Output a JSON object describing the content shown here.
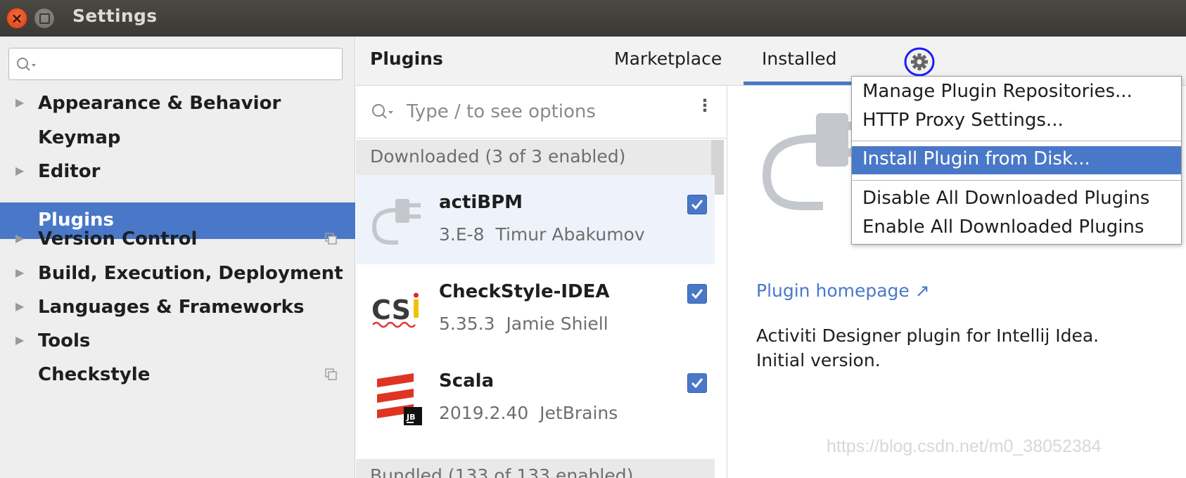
{
  "window": {
    "title": "Settings"
  },
  "sidebar": {
    "search_placeholder": "",
    "items": [
      {
        "label": "Appearance & Behavior",
        "expandable": true,
        "project_icon": false
      },
      {
        "label": "Keymap",
        "expandable": false,
        "project_icon": false
      },
      {
        "label": "Editor",
        "expandable": true,
        "project_icon": false
      },
      {
        "label": "Plugins",
        "expandable": false,
        "project_icon": false,
        "selected": true
      },
      {
        "label": "Version Control",
        "expandable": true,
        "project_icon": true
      },
      {
        "label": "Build, Execution, Deployment",
        "expandable": true,
        "project_icon": false
      },
      {
        "label": "Languages & Frameworks",
        "expandable": true,
        "project_icon": false
      },
      {
        "label": "Tools",
        "expandable": true,
        "project_icon": false
      },
      {
        "label": "Checkstyle",
        "expandable": false,
        "project_icon": true
      }
    ]
  },
  "header": {
    "title": "Plugins",
    "tabs": [
      {
        "label": "Marketplace",
        "active": false
      },
      {
        "label": "Installed",
        "active": true
      }
    ],
    "gear_icon": "gear-icon"
  },
  "plugin_list": {
    "search_placeholder": "Type / to see options",
    "downloaded_group": "Downloaded (3 of 3 enabled)",
    "bundled_group": "Bundled (133 of 133 enabled)",
    "plugins": [
      {
        "name": "actiBPM",
        "version": "3.E-8",
        "vendor": "Timur Abakumov",
        "enabled": true,
        "icon": "plug-icon"
      },
      {
        "name": "CheckStyle-IDEA",
        "version": "5.35.3",
        "vendor": "Jamie Shiell",
        "enabled": true,
        "icon": "checkstyle-logo-icon"
      },
      {
        "name": "Scala",
        "version": "2019.2.40",
        "vendor": "JetBrains",
        "enabled": true,
        "icon": "scala-logo-icon"
      }
    ]
  },
  "details": {
    "homepage_label": "Plugin homepage ↗",
    "description_line1": "Activiti Designer plugin for Intellij Idea.",
    "description_line2": "Initial version."
  },
  "gear_menu": {
    "items": [
      {
        "label": "Manage Plugin Repositories...",
        "highlighted": false
      },
      {
        "label": "HTTP Proxy Settings...",
        "highlighted": false
      },
      {
        "label": "Install Plugin from Disk...",
        "highlighted": true
      },
      {
        "label": "Disable All Downloaded Plugins",
        "highlighted": false
      },
      {
        "label": "Enable All Downloaded Plugins",
        "highlighted": false
      }
    ]
  },
  "watermark": "https://blog.csdn.net/m0_38052384",
  "colors": {
    "accent": "#4a78c8",
    "sidebar_bg": "#eeeeee",
    "titlebar": "#3c3b37",
    "annotation": "#1a1aff"
  }
}
